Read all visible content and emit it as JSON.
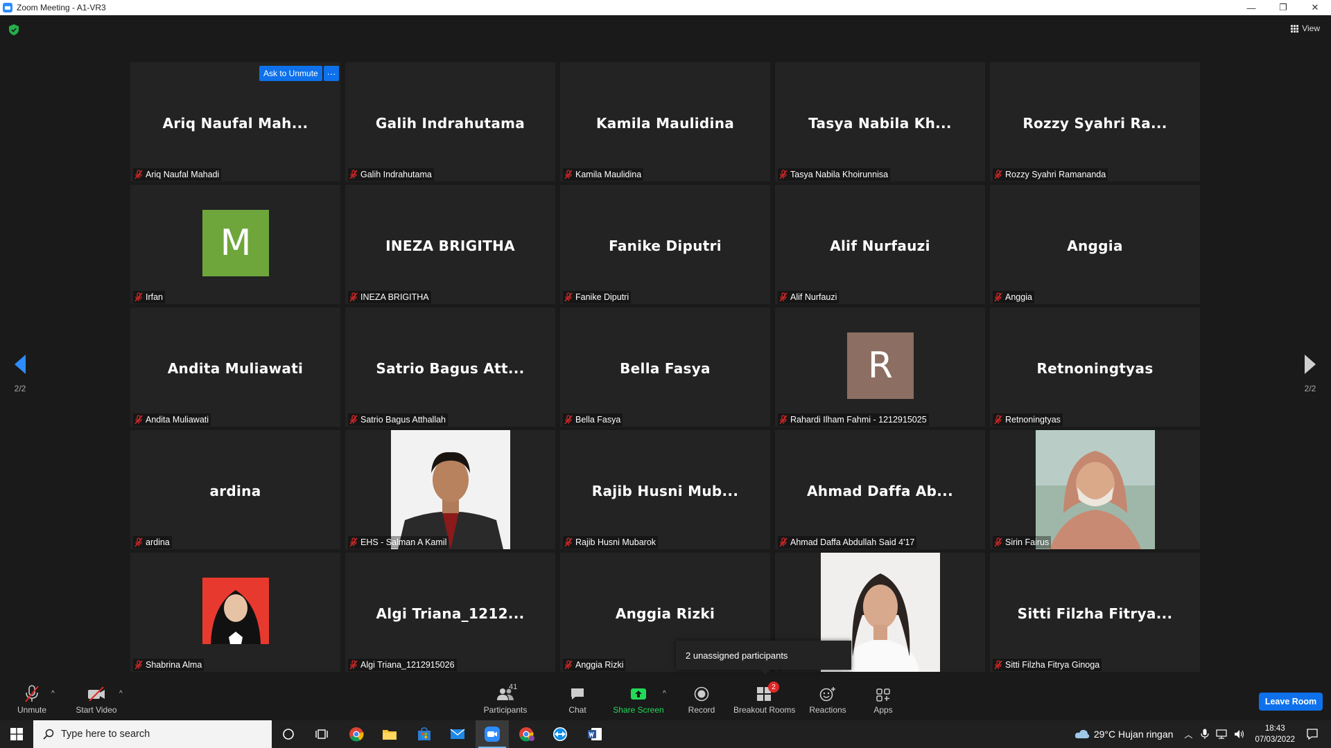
{
  "window": {
    "title": "Zoom Meeting - A1-VR3",
    "controls": [
      "—",
      "❐",
      "✕"
    ]
  },
  "topbar": {
    "view_label": "View"
  },
  "hover_actions": {
    "ask_unmute": "Ask to Unmute",
    "more": "···"
  },
  "tiles": [
    {
      "big": "Ariq  Naufal  Mah...",
      "label": "Ariq Naufal Mahadi"
    },
    {
      "big": "Galih Indrahutama",
      "label": "Galih Indrahutama"
    },
    {
      "big": "Kamila Maulidina",
      "label": "Kamila Maulidina"
    },
    {
      "big": "Tasya  Nabila  Kh...",
      "label": "Tasya Nabila Khoirunnisa"
    },
    {
      "big": "Rozzy  Syahri  Ra...",
      "label": "Rozzy Syahri Ramananda"
    },
    {
      "avatar_letter": "M",
      "label": "Irfan"
    },
    {
      "big": "INEZA BRIGITHA",
      "label": "INEZA BRIGITHA"
    },
    {
      "big": "Fanike Diputri",
      "label": "Fanike Diputri"
    },
    {
      "big": "Alif Nurfauzi",
      "label": "Alif Nurfauzi"
    },
    {
      "big": "Anggia",
      "label": "Anggia"
    },
    {
      "big": "Andita Muliawati",
      "label": "Andita Muliawati"
    },
    {
      "big": "Satrio  Bagus  Att...",
      "label": "Satrio Bagus Atthallah"
    },
    {
      "big": "Bella Fasya",
      "label": "Bella Fasya"
    },
    {
      "avatar_letter": "R",
      "label": "Rahardi Ilham Fahmi - 1212915025"
    },
    {
      "big": "Retnoningtyas",
      "label": "Retnoningtyas"
    },
    {
      "big": "ardina",
      "label": "ardina"
    },
    {
      "label": "EHS - Salman A Kamil"
    },
    {
      "big": "Rajib  Husni  Mub...",
      "label": "Rajib Husni Mubarok"
    },
    {
      "big": "Ahmad  Daffa  Ab...",
      "label": "Ahmad Daffa Abdullah Said 4'17"
    },
    {
      "label": "Sirin Fairus"
    },
    {
      "label": "Shabrina Alma"
    },
    {
      "big": "Algi  Triana_1212...",
      "label": "Algi Triana_1212915026"
    },
    {
      "big": "Anggia Rizki",
      "label": "Anggia Rizki"
    },
    {
      "label": ""
    },
    {
      "big": "Sitti  Filzha  Fitrya...",
      "label": "Sitti Filzha Fitrya Ginoga"
    }
  ],
  "pager": {
    "left": "2/2",
    "right": "2/2"
  },
  "tooltip": "2 unassigned participants",
  "toolbar": {
    "unmute": "Unmute",
    "start_video": "Start Video",
    "participants": "Participants",
    "participants_count": "41",
    "chat": "Chat",
    "share_screen": "Share Screen",
    "record": "Record",
    "breakout_rooms": "Breakout Rooms",
    "breakout_badge": "2",
    "reactions": "Reactions",
    "apps": "Apps",
    "leave": "Leave Room"
  },
  "taskbar": {
    "search_placeholder": "Type here to search",
    "weather": "29°C  Hujan ringan",
    "time": "18:43",
    "date": "07/03/2022"
  },
  "colors": {
    "avatar_M": "#6EA63C",
    "avatar_R": "#8C6E62",
    "zoom_blue": "#0E71EB",
    "share_green": "#23D959"
  }
}
